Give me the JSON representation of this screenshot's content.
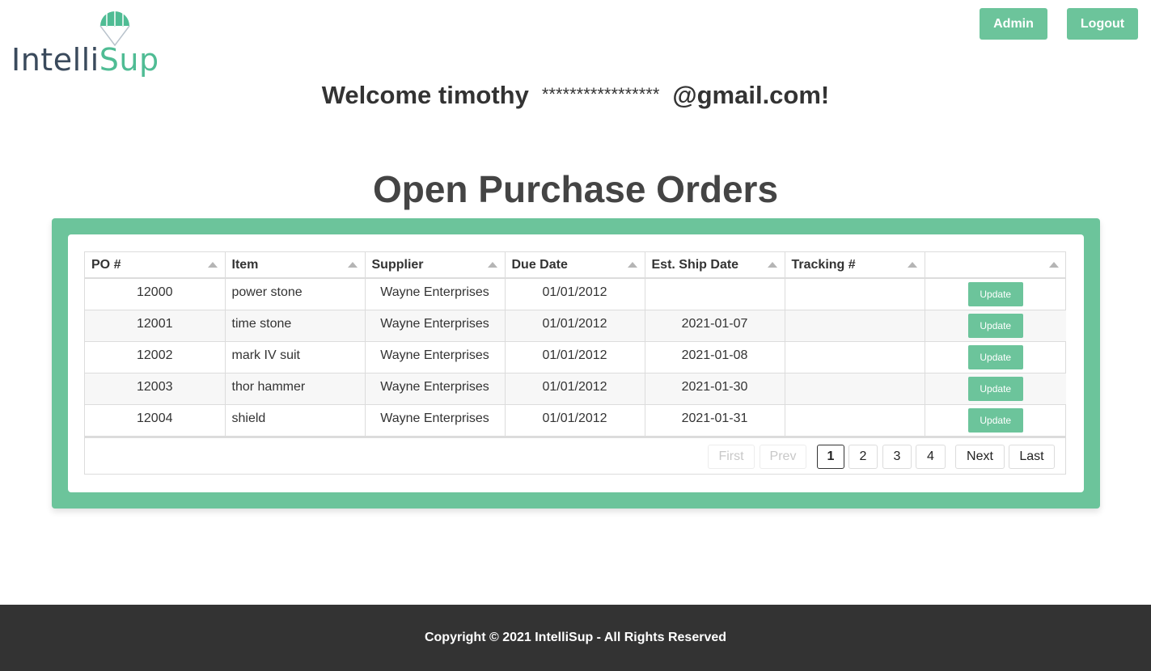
{
  "header": {
    "logo_text_a": "Intelli",
    "logo_text_b": "Sup",
    "admin_label": "Admin",
    "logout_label": "Logout"
  },
  "welcome": {
    "prefix": "Welcome timothy",
    "masked": "*****************",
    "suffix": "@gmail.com!"
  },
  "page_title": "Open Purchase Orders",
  "table": {
    "columns": [
      "PO #",
      "Item",
      "Supplier",
      "Due Date",
      "Est. Ship Date",
      "Tracking #",
      ""
    ],
    "rows": [
      {
        "po": "12000",
        "item": "power stone",
        "supplier": "Wayne Enterprises",
        "due": "01/01/2012",
        "ship": "",
        "tracking": "",
        "action": "Update"
      },
      {
        "po": "12001",
        "item": "time stone",
        "supplier": "Wayne Enterprises",
        "due": "01/01/2012",
        "ship": "2021-01-07",
        "tracking": "",
        "action": "Update"
      },
      {
        "po": "12002",
        "item": "mark IV suit",
        "supplier": "Wayne Enterprises",
        "due": "01/01/2012",
        "ship": "2021-01-08",
        "tracking": "",
        "action": "Update"
      },
      {
        "po": "12003",
        "item": "thor hammer",
        "supplier": "Wayne Enterprises",
        "due": "01/01/2012",
        "ship": "2021-01-30",
        "tracking": "",
        "action": "Update"
      },
      {
        "po": "12004",
        "item": "shield",
        "supplier": "Wayne Enterprises",
        "due": "01/01/2012",
        "ship": "2021-01-31",
        "tracking": "",
        "action": "Update"
      }
    ]
  },
  "pagination": {
    "first": "First",
    "prev": "Prev",
    "pages": [
      "1",
      "2",
      "3",
      "4"
    ],
    "current": "1",
    "next": "Next",
    "last": "Last"
  },
  "footer": {
    "copyright": "Copyright © 2021 IntelliSup - All Rights Reserved"
  },
  "colors": {
    "accent": "#6cc49b",
    "footer_bg": "#333333",
    "logo_text": "#3a4a5c"
  }
}
